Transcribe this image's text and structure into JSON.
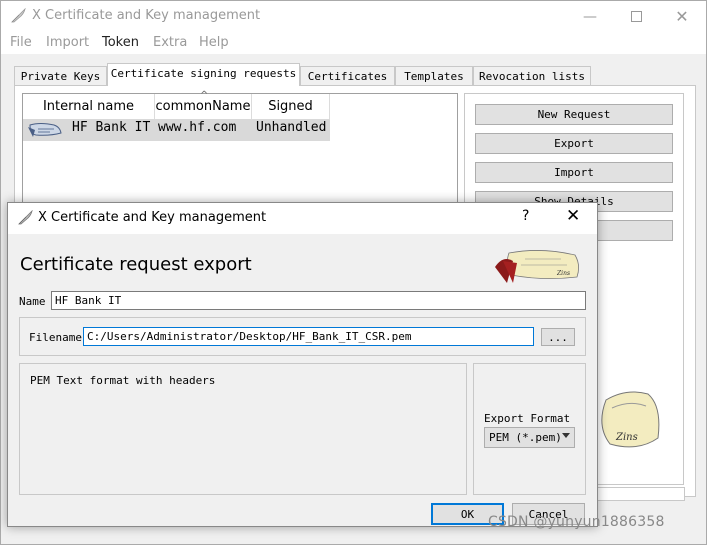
{
  "main_window": {
    "title": "X Certificate and Key management",
    "menu": [
      {
        "label": "File",
        "active": false
      },
      {
        "label": "Import",
        "active": false
      },
      {
        "label": "Token",
        "active": true
      },
      {
        "label": "Extra",
        "active": false
      },
      {
        "label": "Help",
        "active": false
      }
    ],
    "tabs": [
      {
        "label": "Private Keys",
        "active": false
      },
      {
        "label": "Certificate signing requests",
        "active": true
      },
      {
        "label": "Certificates",
        "active": false
      },
      {
        "label": "Templates",
        "active": false
      },
      {
        "label": "Revocation lists",
        "active": false
      }
    ],
    "table": {
      "columns": [
        "Internal name",
        "commonName",
        "Signed"
      ],
      "rows": [
        {
          "internal_name": "HF Bank IT",
          "common_name": "www.hf.com",
          "signed": "Unhandled",
          "icon": "csr-scroll-icon"
        }
      ]
    },
    "side_buttons": [
      "New Request",
      "Export",
      "Import",
      "Show Details",
      ""
    ]
  },
  "dialog": {
    "title": "X Certificate and Key management",
    "help_glyph": "?",
    "close_glyph": "✕",
    "heading": "Certificate request export",
    "name_label": "Name",
    "name_value": "HF Bank IT",
    "filename_label": "Filename",
    "filename_value": "C:/Users/Administrator/Desktop/HF_Bank_IT_CSR.pem",
    "browse_label": "...",
    "format_description": "PEM Text format with headers",
    "export_format_label": "Export Format",
    "export_format_value": "PEM (*.pem)",
    "ok_label": "OK",
    "cancel_label": "Cancel"
  },
  "watermark": "CSDN @yunyun1886358",
  "colors": {
    "focus_border": "#0078d7",
    "selection_row": "#d9d9d9",
    "button_face": "#e1e1e1",
    "window_bg": "#f0f0f0"
  }
}
